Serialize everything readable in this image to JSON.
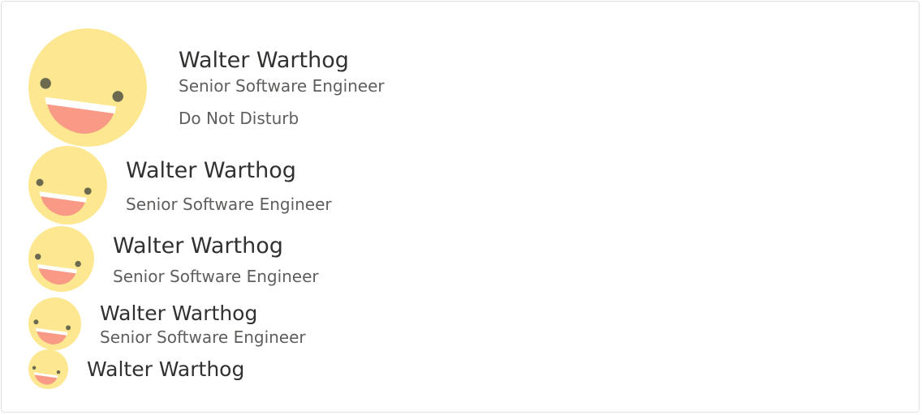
{
  "colors": {
    "face": "#fde891",
    "eyes": "#6b6a4f",
    "mouth": "#f89a86",
    "teeth": "#ffffff",
    "name_text": "#323130",
    "secondary_text": "#605e5c",
    "border": "#e1e1e1"
  },
  "personas": [
    {
      "name": "Walter Warthog",
      "role": "Senior Software Engineer",
      "status": "Do Not Disturb",
      "avatar_icon": "smiley-face-icon"
    },
    {
      "name": "Walter Warthog",
      "role": "Senior Software Engineer",
      "avatar_icon": "smiley-face-icon"
    },
    {
      "name": "Walter Warthog",
      "role": "Senior Software Engineer",
      "avatar_icon": "smiley-face-icon"
    },
    {
      "name": "Walter Warthog",
      "role": "Senior Software Engineer",
      "avatar_icon": "smiley-face-icon"
    },
    {
      "name": "Walter Warthog",
      "avatar_icon": "smiley-face-icon"
    }
  ]
}
